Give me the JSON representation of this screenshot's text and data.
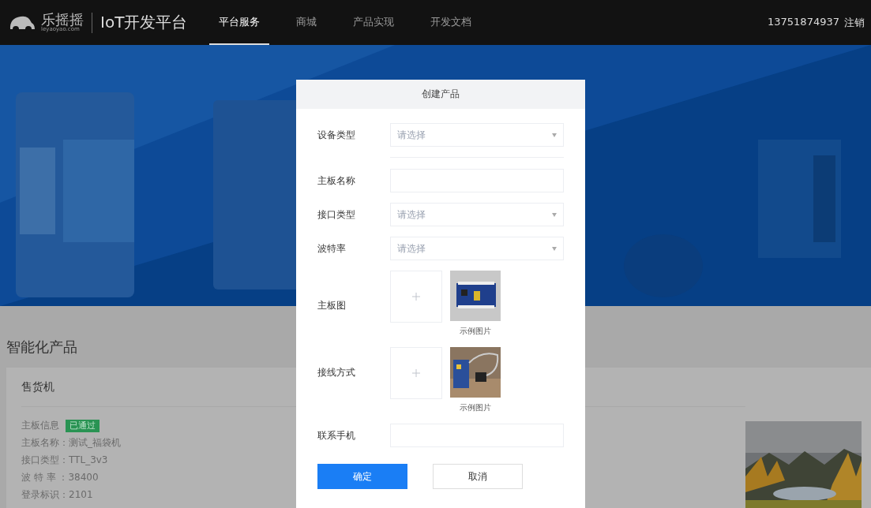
{
  "nav": {
    "logo_text": "乐摇摇",
    "logo_sub": "leyaoyao.com",
    "platform": "IoT开发平台",
    "items": [
      {
        "label": "平台服务",
        "selected": true
      },
      {
        "label": "商城",
        "selected": false
      },
      {
        "label": "产品实现",
        "selected": false
      },
      {
        "label": "开发文档",
        "selected": false
      }
    ],
    "account": "13751874937",
    "logout": "注销"
  },
  "section": {
    "title": "智能化产品",
    "card": {
      "title": "售货机",
      "info_label": "主板信息",
      "status": "已通过",
      "fields": [
        "主板名称：测试_福袋机",
        "接口类型：TTL_3v3",
        "波 特 率 ：38400",
        "登录标识：2101"
      ]
    }
  },
  "dialog": {
    "title": "创建产品",
    "rows": [
      {
        "kind": "select",
        "label": "设备类型",
        "placeholder": "请选择"
      },
      {
        "kind": "divider"
      },
      {
        "kind": "input",
        "label": "主板名称"
      },
      {
        "kind": "select",
        "label": "接口类型",
        "placeholder": "请选择"
      },
      {
        "kind": "select",
        "label": "波特率",
        "placeholder": "请选择"
      },
      {
        "kind": "upload",
        "label": "主板图",
        "caption": "示例图片"
      },
      {
        "kind": "upload",
        "label": "接线方式",
        "caption": "示例图片"
      },
      {
        "kind": "input",
        "label": "联系手机"
      }
    ],
    "confirm": "确定",
    "cancel": "取消"
  }
}
